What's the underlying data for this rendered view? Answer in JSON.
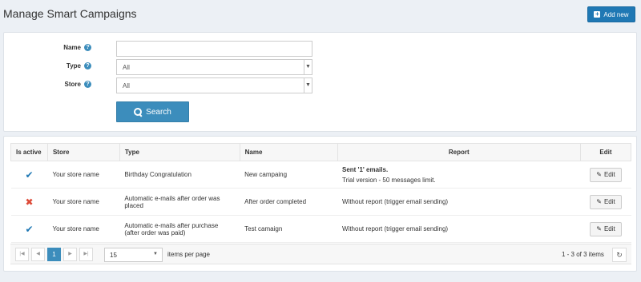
{
  "header": {
    "title": "Manage Smart Campaigns",
    "add_label": "Add new"
  },
  "search": {
    "name_label": "Name",
    "name_value": "",
    "type_label": "Type",
    "type_value": "All",
    "store_label": "Store",
    "store_value": "All",
    "search_label": "Search"
  },
  "grid": {
    "columns": [
      "Is active",
      "Store",
      "Type",
      "Name",
      "Report",
      "Edit"
    ],
    "rows": [
      {
        "active": true,
        "active_glyph": "✔",
        "store": "Your store name",
        "type": "Birthday Congratulation",
        "name": "New campaing",
        "report_title": "Sent '1' emails.",
        "report_sub": "Trial version - 50 messages limit.",
        "edit_label": "Edit"
      },
      {
        "active": false,
        "active_glyph": "✖",
        "store": "Your store name",
        "type": "Automatic e-mails after order was placed",
        "name": "After order completed",
        "report_title": "",
        "report_sub": "Without report (trigger email sending)",
        "edit_label": "Edit"
      },
      {
        "active": true,
        "active_glyph": "✔",
        "store": "Your store name",
        "type": "Automatic e-mails after purchase (after order was paid)",
        "name": "Test camaign",
        "report_title": "",
        "report_sub": "Without report (trigger email sending)",
        "edit_label": "Edit"
      }
    ]
  },
  "pager": {
    "current_page": "1",
    "page_size": "15",
    "per_page_label": "items per page",
    "items_info": "1 - 3 of 3 items"
  },
  "icons": {
    "help": "?",
    "first": "|◀",
    "prev": "◀",
    "next": "▶",
    "last": "▶|",
    "refresh": "↻",
    "dropdown": "▼",
    "pencil": "✎"
  },
  "colors": {
    "primary": "#3c8dbc",
    "add_button": "#1f78b4",
    "active_check": "#1f78b4",
    "inactive_cross": "#dd4b39",
    "background": "#ecf0f5"
  }
}
